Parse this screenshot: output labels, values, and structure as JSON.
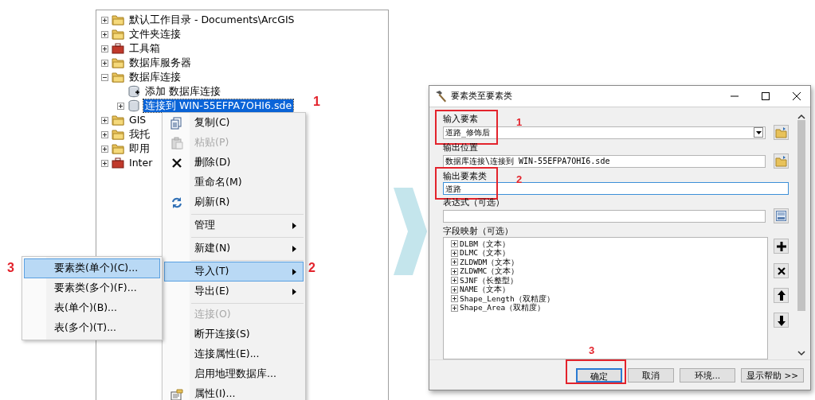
{
  "tree": {
    "items": [
      {
        "label": "默认工作目录 - Documents\\ArcGIS",
        "expanded": false,
        "selected": false
      },
      {
        "label": "文件夹连接",
        "expanded": false,
        "selected": false
      },
      {
        "label": "工具箱",
        "expanded": false,
        "selected": false
      },
      {
        "label": "数据库服务器",
        "expanded": false,
        "selected": false
      },
      {
        "label": "数据库连接",
        "expanded": true,
        "selected": false,
        "children": [
          {
            "label": "添加 数据库连接",
            "selected": false
          },
          {
            "label": "连接到 WIN-55EFPA7OHI6.sde",
            "expanded": false,
            "selected": true
          }
        ]
      },
      {
        "label": "GIS",
        "expanded": false,
        "selected": false
      },
      {
        "label": "我托",
        "expanded": false,
        "selected": false
      },
      {
        "label": "即用",
        "expanded": false,
        "selected": false
      },
      {
        "label": "Inter",
        "expanded": false,
        "selected": false
      }
    ]
  },
  "context_menu": {
    "items": [
      {
        "kind": "item",
        "label": "复制(C)",
        "disabled": false,
        "selected": false,
        "submenu": false
      },
      {
        "kind": "item",
        "label": "粘贴(P)",
        "disabled": true,
        "selected": false,
        "submenu": false
      },
      {
        "kind": "item",
        "label": "删除(D)",
        "disabled": false,
        "selected": false,
        "submenu": false
      },
      {
        "kind": "item",
        "label": "重命名(M)",
        "disabled": false,
        "selected": false,
        "submenu": false
      },
      {
        "kind": "item",
        "label": "刷新(R)",
        "disabled": false,
        "selected": false,
        "submenu": false
      },
      {
        "kind": "separator"
      },
      {
        "kind": "item",
        "label": "管理",
        "disabled": false,
        "selected": false,
        "submenu": true
      },
      {
        "kind": "separator"
      },
      {
        "kind": "item",
        "label": "新建(N)",
        "disabled": false,
        "selected": false,
        "submenu": true
      },
      {
        "kind": "separator"
      },
      {
        "kind": "item",
        "label": "导入(T)",
        "disabled": false,
        "selected": true,
        "submenu": true
      },
      {
        "kind": "item",
        "label": "导出(E)",
        "disabled": false,
        "selected": false,
        "submenu": true
      },
      {
        "kind": "separator"
      },
      {
        "kind": "item",
        "label": "连接(O)",
        "disabled": true,
        "selected": false,
        "submenu": false
      },
      {
        "kind": "item",
        "label": "断开连接(S)",
        "disabled": false,
        "selected": false,
        "submenu": false
      },
      {
        "kind": "item",
        "label": "连接属性(E)...",
        "disabled": false,
        "selected": false,
        "submenu": false
      },
      {
        "kind": "item",
        "label": "启用地理数据库...",
        "disabled": false,
        "selected": false,
        "submenu": false
      },
      {
        "kind": "item",
        "label": "属性(I)...",
        "disabled": false,
        "selected": false,
        "submenu": false
      }
    ]
  },
  "submenu": {
    "items": [
      {
        "label": "要素类(单个)(C)...",
        "selected": true
      },
      {
        "label": "要素类(多个)(F)...",
        "selected": false
      },
      {
        "label": "表(单个)(B)...",
        "selected": false
      },
      {
        "label": "表(多个)(T)...",
        "selected": false
      }
    ]
  },
  "dialog": {
    "title": "要素类至要素类",
    "fields": [
      {
        "kind": "combo",
        "label": "输入要素",
        "value": "道路_修饰后",
        "focused": false
      },
      {
        "kind": "browse",
        "label": "输出位置",
        "value": "数据库连接\\连接到 WIN-55EFPA7OHI6.sde",
        "focused": false
      },
      {
        "kind": "text",
        "label": "输出要素类",
        "value": "道路",
        "focused": true
      },
      {
        "kind": "sql",
        "label": "表达式（可选）",
        "focused": false
      }
    ],
    "field_map": {
      "label": "字段映射（可选）",
      "items": [
        "DLBM（文本）",
        "DLMC（文本）",
        "ZLDWDM（文本）",
        "ZLDWMC（文本）",
        "SJNF（长整型）",
        "NAME（文本）",
        "Shape_Length（双精度）",
        "Shape_Area（双精度）"
      ]
    },
    "buttons": [
      {
        "label": "确定",
        "selected": true
      },
      {
        "label": "取消",
        "selected": false
      },
      {
        "label": "环境...",
        "selected": false
      },
      {
        "label": "显示帮助 >>",
        "selected": false
      }
    ]
  },
  "annotations": [
    {
      "text": "1"
    },
    {
      "text": "2"
    },
    {
      "text": "3"
    },
    {
      "text": "1"
    },
    {
      "text": "2"
    },
    {
      "text": "3"
    }
  ]
}
